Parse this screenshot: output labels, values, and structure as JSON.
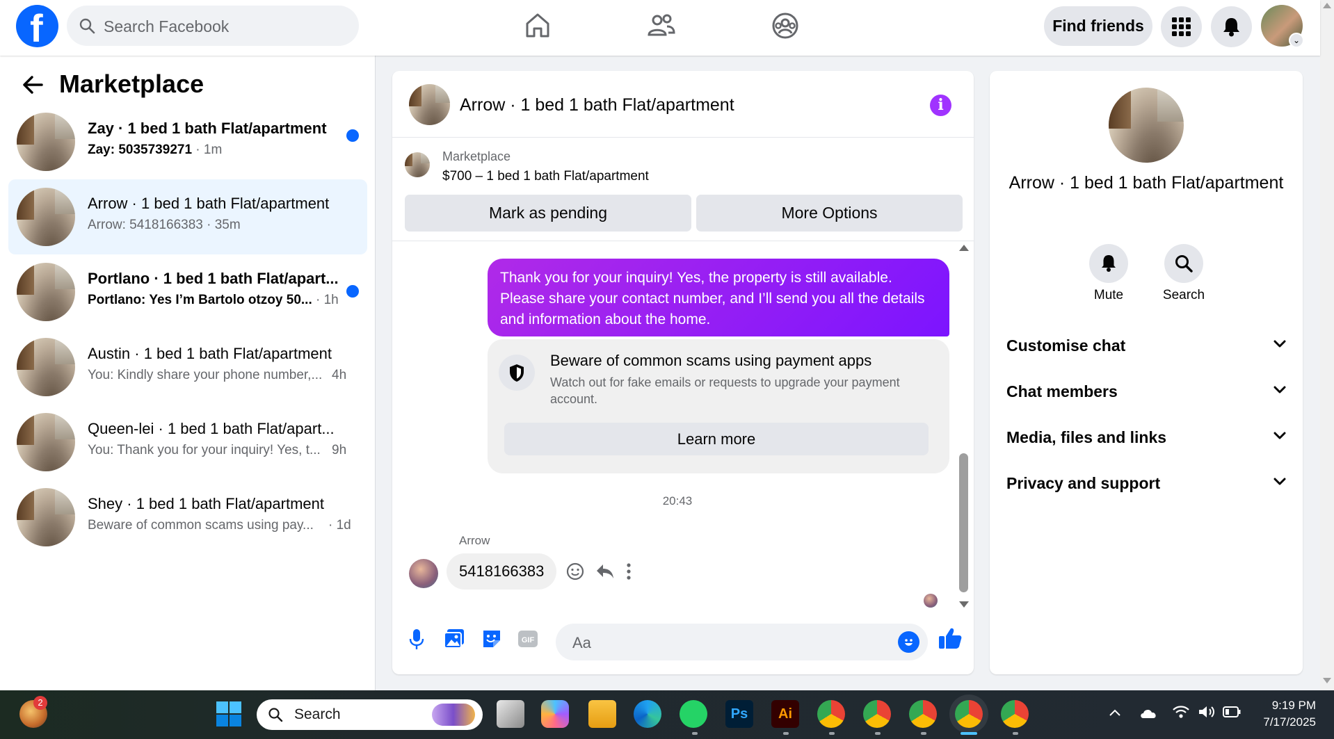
{
  "header": {
    "search_placeholder": "Search Facebook",
    "find_friends": "Find friends"
  },
  "left": {
    "title": "Marketplace",
    "conversations": [
      {
        "name": "Zay · 1 bed 1 bath Flat/apartment",
        "preview": "Zay: 5035739271",
        "time": " · 1m",
        "unread": true
      },
      {
        "name": "Arrow · 1 bed 1 bath Flat/apartment",
        "preview": "Arrow: 5418166383 · 35m",
        "time": "",
        "unread": false,
        "active": true
      },
      {
        "name": "Portlano · 1 bed 1 bath Flat/apart...",
        "preview": "Portlano: Yes I’m Bartolo otzoy 50...",
        "time": " · 1h",
        "unread": true
      },
      {
        "name": "Austin · 1 bed 1 bath Flat/apartment",
        "preview": "You: Kindly share your phone number,...",
        "time": "4h",
        "unread": false
      },
      {
        "name": "Queen-lei · 1 bed 1 bath Flat/apart...",
        "preview": "You: Thank you for your inquiry! Yes, t...",
        "time": "9h",
        "unread": false
      },
      {
        "name": "Shey · 1 bed 1 bath Flat/apartment",
        "preview": "Beware of common scams using pay...",
        "time": "· 1d",
        "unread": false
      }
    ]
  },
  "chat": {
    "title": "Arrow · 1 bed 1 bath Flat/apartment",
    "marketplace_label": "Marketplace",
    "listing": "$700 – 1 bed 1 bath Flat/apartment",
    "mark_pending": "Mark as pending",
    "more_options": "More Options",
    "outgoing_message": "Thank you for your inquiry! Yes, the property is still available. Please share your contact number, and I’ll send you all the details and information about the home.",
    "scam_title": "Beware of common scams using payment apps",
    "scam_body": "Watch out for fake emails or requests to upgrade your payment account.",
    "learn_more": "Learn more",
    "timestamp": "20:43",
    "sender": "Arrow",
    "incoming_message": "5418166383",
    "composer_placeholder": "Aa"
  },
  "right": {
    "title": "Arrow · 1 bed 1 bath Flat/apartment",
    "mute": "Mute",
    "search": "Search",
    "sections": [
      "Customise chat",
      "Chat members",
      "Media, files and links",
      "Privacy and support"
    ]
  },
  "taskbar": {
    "search_placeholder": "Search",
    "notification_count": "2",
    "time": "9:19 PM",
    "date": "7/17/2025"
  },
  "colors": {
    "facebook_blue": "#0866ff",
    "messenger_purple": "#a033ff",
    "unread_dot": "#0866ff"
  }
}
